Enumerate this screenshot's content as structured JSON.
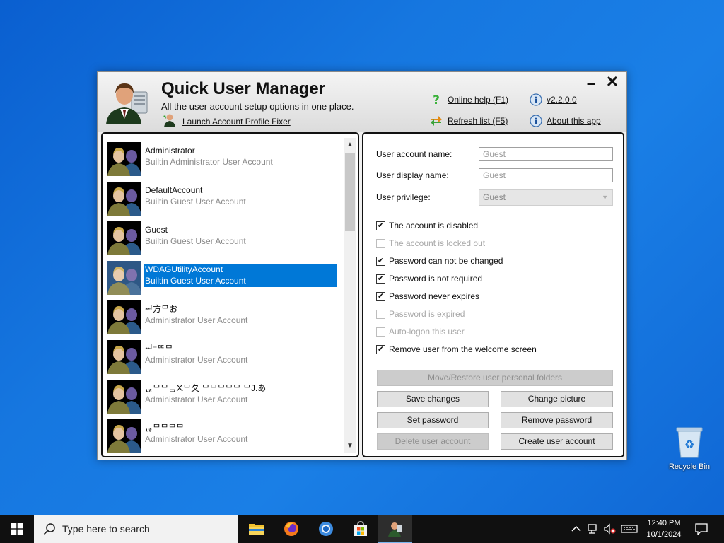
{
  "app": {
    "title": "Quick User Manager",
    "subtitle": "All the user account setup options in one place.",
    "links": {
      "launch_fixer": "Launch Account Profile Fixer",
      "online_help": "Online help (F1)",
      "refresh_list": "Refresh list (F5)",
      "version": "v2.2.0.0",
      "about": "About this app"
    },
    "window_controls": {
      "minimize": "–",
      "close": "✕"
    }
  },
  "users": [
    {
      "name": "Administrator",
      "desc": "Builtin Administrator User Account"
    },
    {
      "name": "DefaultAccount",
      "desc": "Builtin Guest User Account"
    },
    {
      "name": "Guest",
      "desc": "Builtin Guest User Account"
    },
    {
      "name": "WDAGUtilityAccount",
      "desc": "Builtin Guest User Account"
    },
    {
      "name": "ᆈ⽅ᄆお",
      "desc": "Administrator User Account"
    },
    {
      "name": "ᆈ⁻ᄆᄃᄆ",
      "desc": "Administrator User Account"
    },
    {
      "name": "ᆭᄆᄆᆷ᙭ᄆ夂 ᄆᄆᄆᄆᄆ ᄆJ.あ",
      "desc": "Administrator User Account"
    },
    {
      "name": "ᆭᄆᄆᄆᄆ",
      "desc": "Administrator User Account"
    }
  ],
  "selected_user_index": 3,
  "details": {
    "labels": {
      "account_name": "User account name:",
      "display_name": "User display name:",
      "privilege": "User privilege:"
    },
    "values": {
      "account_name": "Guest",
      "display_name": "Guest",
      "privilege": "Guest"
    },
    "checkboxes": [
      {
        "label": "The account is disabled",
        "checked": true,
        "disabled": false
      },
      {
        "label": "The account is locked out",
        "checked": false,
        "disabled": true
      },
      {
        "label": "Password can not be changed",
        "checked": true,
        "disabled": false
      },
      {
        "label": "Password is not required",
        "checked": true,
        "disabled": false
      },
      {
        "label": "Password never expires",
        "checked": true,
        "disabled": false
      },
      {
        "label": "Password is expired",
        "checked": false,
        "disabled": true
      },
      {
        "label": "Auto-logon this user",
        "checked": false,
        "disabled": true
      },
      {
        "label": "Remove user from the welcome screen",
        "checked": true,
        "disabled": false
      }
    ],
    "buttons": {
      "move_restore": "Move/Restore user personal folders",
      "save_changes": "Save changes",
      "change_picture": "Change picture",
      "set_password": "Set password",
      "remove_password": "Remove password",
      "delete_user": "Delete user account",
      "create_user": "Create user account"
    }
  },
  "desktop": {
    "recycle_bin": "Recycle Bin"
  },
  "taskbar": {
    "search_placeholder": "Type here to search",
    "time": "12:40 PM",
    "date": "10/1/2024"
  }
}
